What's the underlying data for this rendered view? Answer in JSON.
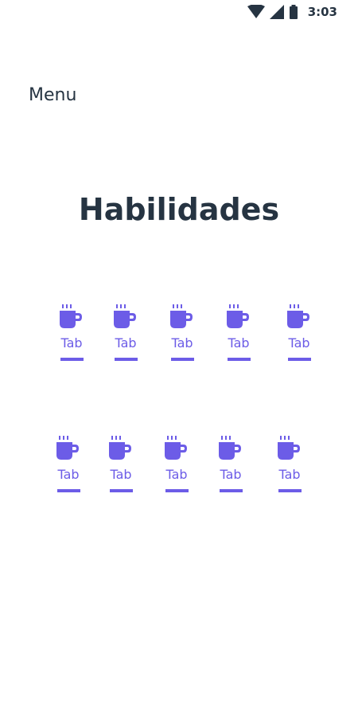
{
  "status_bar": {
    "time": "3:03",
    "icons": [
      "wifi-icon",
      "signal-icon",
      "battery-icon"
    ]
  },
  "menu": {
    "label": "Menu"
  },
  "title": "Habilidades",
  "accent_color": "#6c5ce7",
  "text_color": "#263442",
  "tab_rows": [
    {
      "tabs": [
        {
          "label": "Tab",
          "icon": "coffee-cup-icon"
        },
        {
          "label": "Tab",
          "icon": "coffee-cup-icon"
        },
        {
          "label": "Tab",
          "icon": "coffee-cup-icon"
        },
        {
          "label": "Tab",
          "icon": "coffee-cup-icon"
        },
        {
          "label": "Tab",
          "icon": "coffee-cup-icon"
        }
      ]
    },
    {
      "tabs": [
        {
          "label": "Tab",
          "icon": "coffee-cup-icon"
        },
        {
          "label": "Tab",
          "icon": "coffee-cup-icon"
        },
        {
          "label": "Tab",
          "icon": "coffee-cup-icon"
        },
        {
          "label": "Tab",
          "icon": "coffee-cup-icon"
        },
        {
          "label": "Tab",
          "icon": "coffee-cup-icon"
        }
      ]
    }
  ]
}
